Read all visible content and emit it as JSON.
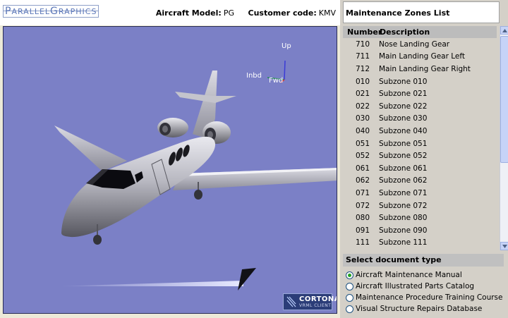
{
  "logo": {
    "part1_big": "P",
    "part1": "ARALLEL",
    "part2_big": "G",
    "part2": "RAPHICS"
  },
  "aircraft": {
    "model_label": "Aircraft Model:",
    "model_value": "PG",
    "customer_label": "Customer code:",
    "customer_value": "KMV"
  },
  "viewer": {
    "axis_up": "Up",
    "axis_inbd": "Inbd",
    "axis_fwd": "Fwd",
    "badge_main": "CORTONA",
    "badge_sub": "VRML CLIENT"
  },
  "zones": {
    "title": "Maintenance Zones List",
    "columns": {
      "number": "Number",
      "description": "Description"
    },
    "rows": [
      {
        "number": "710",
        "description": "Nose Landing Gear"
      },
      {
        "number": "711",
        "description": "Main Landing Gear Left"
      },
      {
        "number": "712",
        "description": "Main Landing Gear Right"
      },
      {
        "number": "010",
        "description": "Subzone 010"
      },
      {
        "number": "021",
        "description": "Subzone 021"
      },
      {
        "number": "022",
        "description": "Subzone 022"
      },
      {
        "number": "030",
        "description": "Subzone 030"
      },
      {
        "number": "040",
        "description": "Subzone 040"
      },
      {
        "number": "051",
        "description": "Subzone 051"
      },
      {
        "number": "052",
        "description": "Subzone 052"
      },
      {
        "number": "061",
        "description": "Subzone 061"
      },
      {
        "number": "062",
        "description": "Subzone 062"
      },
      {
        "number": "071",
        "description": "Subzone 071"
      },
      {
        "number": "072",
        "description": "Subzone 072"
      },
      {
        "number": "080",
        "description": "Subzone 080"
      },
      {
        "number": "091",
        "description": "Subzone 090"
      },
      {
        "number": "111",
        "description": "Subzone 111"
      }
    ]
  },
  "document_type": {
    "title": "Select document type",
    "options": [
      {
        "label": "Aircraft Maintenance Manual",
        "selected": true
      },
      {
        "label": "Aircraft Illustrated Parts Catalog",
        "selected": false
      },
      {
        "label": "Maintenance Procedure Training Course",
        "selected": false
      },
      {
        "label": "Visual Structure Repairs Database",
        "selected": false
      }
    ]
  },
  "colors": {
    "viewport_bg": "#7b80c6",
    "radio_selected": "#21a121"
  }
}
